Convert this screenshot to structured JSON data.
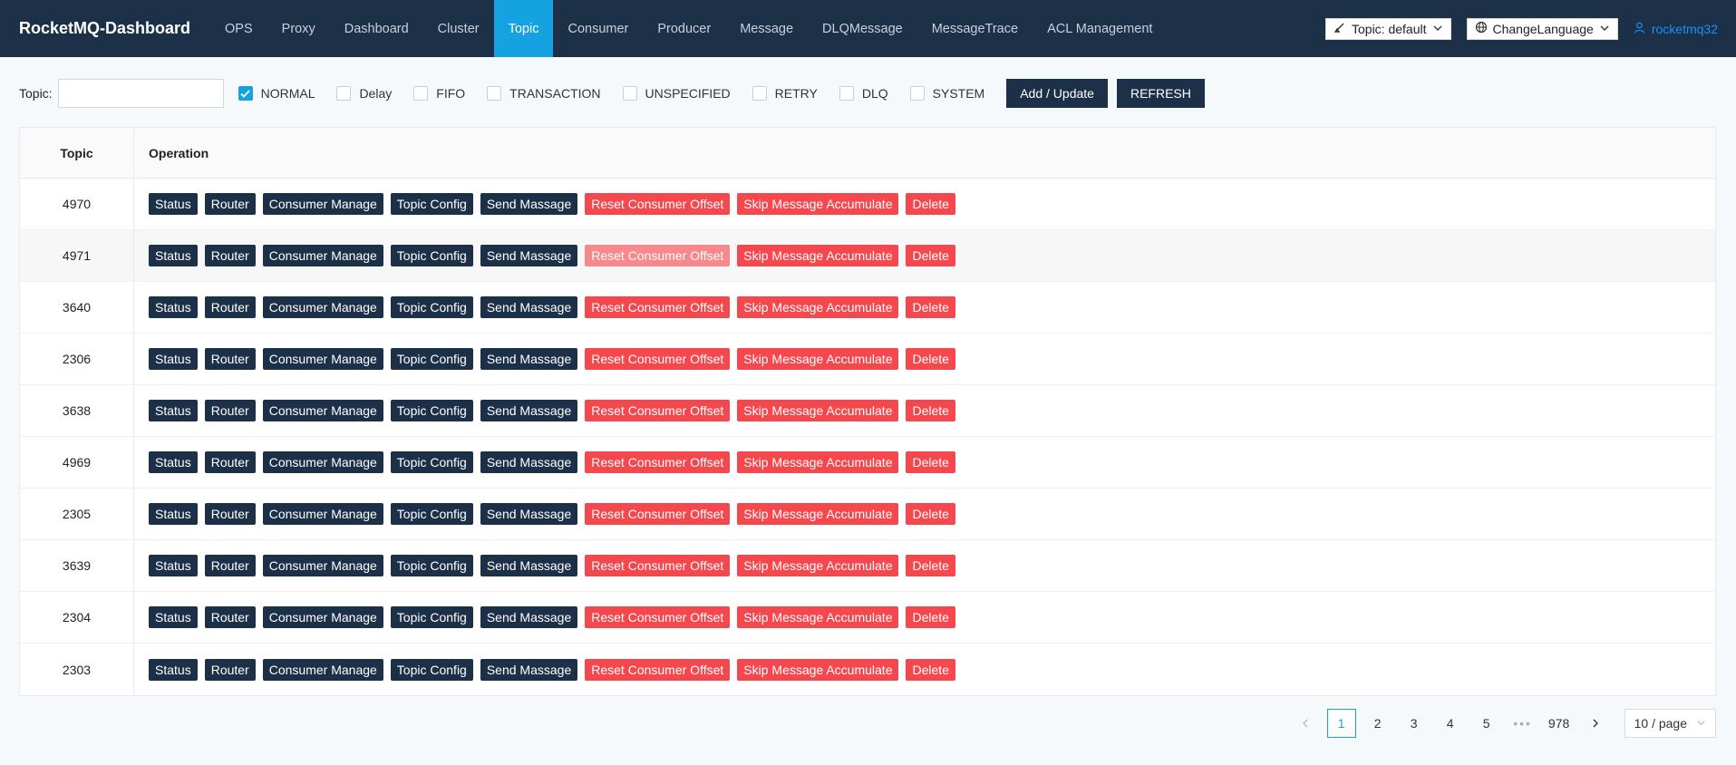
{
  "header": {
    "brand": "RocketMQ-Dashboard",
    "nav": [
      "OPS",
      "Proxy",
      "Dashboard",
      "Cluster",
      "Topic",
      "Consumer",
      "Producer",
      "Message",
      "DLQMessage",
      "MessageTrace",
      "ACL Management"
    ],
    "active_nav": "Topic",
    "topic_select": "Topic: default",
    "language_select": "ChangeLanguage",
    "user": "rocketmq32"
  },
  "filters": {
    "topic_label": "Topic:",
    "topic_value": "",
    "checkboxes": [
      {
        "label": "NORMAL",
        "checked": true
      },
      {
        "label": "Delay",
        "checked": false
      },
      {
        "label": "FIFO",
        "checked": false
      },
      {
        "label": "TRANSACTION",
        "checked": false
      },
      {
        "label": "UNSPECIFIED",
        "checked": false
      },
      {
        "label": "RETRY",
        "checked": false
      },
      {
        "label": "DLQ",
        "checked": false
      },
      {
        "label": "SYSTEM",
        "checked": false
      }
    ],
    "add_update": "Add / Update",
    "refresh": "REFRESH"
  },
  "table": {
    "columns": [
      "Topic",
      "Operation"
    ],
    "operations": [
      "Status",
      "Router",
      "Consumer Manage",
      "Topic Config",
      "Send Massage",
      "Reset Consumer Offset",
      "Skip Message Accumulate",
      "Delete"
    ],
    "rows": [
      "4970",
      "4971",
      "3640",
      "2306",
      "3638",
      "4969",
      "2305",
      "3639",
      "2304",
      "2303"
    ]
  },
  "pagination": {
    "pages": [
      "1",
      "2",
      "3",
      "4",
      "5"
    ],
    "ellipsis": "•••",
    "last_page": "978",
    "current": "1",
    "page_size": "10 / page"
  },
  "colors": {
    "header_bg": "#1c3048",
    "accent": "#14a3e0",
    "danger": "#f4484e"
  }
}
